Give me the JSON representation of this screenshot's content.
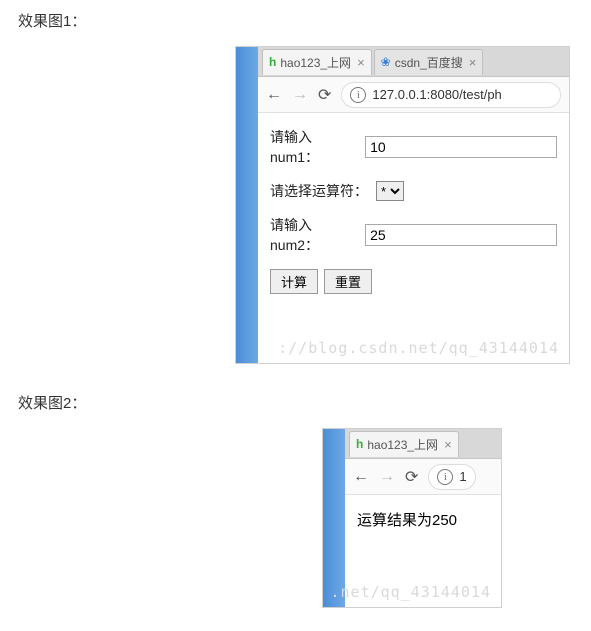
{
  "captions": {
    "fig1": "效果图1：",
    "fig2": "效果图2："
  },
  "browser1": {
    "tabs": [
      {
        "favicon": "hao",
        "title": "hao123_上网",
        "close": "×"
      },
      {
        "favicon": "baidu",
        "title": "csdn_百度搜",
        "close": "×"
      }
    ],
    "nav": {
      "back": "←",
      "forward": "→",
      "reload": "⟳",
      "info": "i"
    },
    "url": "127.0.0.1:8080/test/ph",
    "form": {
      "label_num1": "请输入num1：",
      "value_num1": "10",
      "label_op": "请选择运算符：",
      "op_value": "*",
      "label_num2": "请输入num2：",
      "value_num2": "25",
      "btn_calc": "计算",
      "btn_reset": "重置"
    },
    "watermark": "://blog.csdn.net/qq_43144014"
  },
  "browser2": {
    "tabs": [
      {
        "favicon": "hao",
        "title": "hao123_上网",
        "close": "×"
      }
    ],
    "nav": {
      "back": "←",
      "forward": "→",
      "reload": "⟳",
      "info": "i"
    },
    "url": "1",
    "result": "运算结果为250",
    "watermark": ".net/qq_43144014"
  }
}
